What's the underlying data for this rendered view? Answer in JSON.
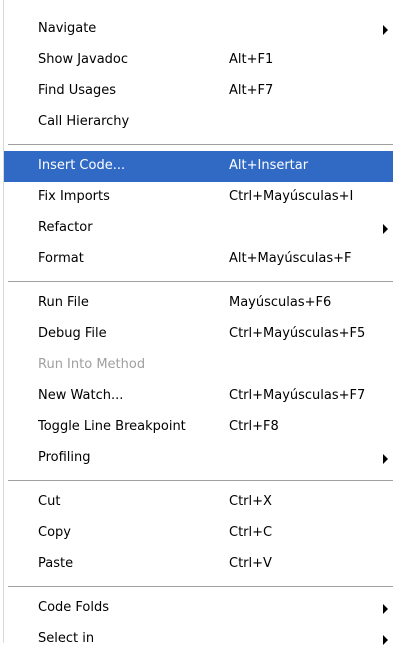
{
  "colors": {
    "selection": "#316ac5",
    "selection_text": "#ffffff",
    "disabled_text": "#a0a0a0",
    "separator": "#a0a0a0"
  },
  "menu": {
    "items": [
      {
        "label": "Navigate",
        "accel": "",
        "submenu": true,
        "selected": false,
        "disabled": false
      },
      {
        "label": "Show Javadoc",
        "accel": "Alt+F1",
        "submenu": false,
        "selected": false,
        "disabled": false
      },
      {
        "label": "Find Usages",
        "accel": "Alt+F7",
        "submenu": false,
        "selected": false,
        "disabled": false
      },
      {
        "label": "Call Hierarchy",
        "accel": "",
        "submenu": false,
        "selected": false,
        "disabled": false
      },
      {
        "label": "Insert Code...",
        "accel": "Alt+Insertar",
        "submenu": false,
        "selected": true,
        "disabled": false
      },
      {
        "label": "Fix Imports",
        "accel": "Ctrl+Mayúsculas+I",
        "submenu": false,
        "selected": false,
        "disabled": false
      },
      {
        "label": "Refactor",
        "accel": "",
        "submenu": true,
        "selected": false,
        "disabled": false
      },
      {
        "label": "Format",
        "accel": "Alt+Mayúsculas+F",
        "submenu": false,
        "selected": false,
        "disabled": false
      },
      {
        "label": "Run File",
        "accel": "Mayúsculas+F6",
        "submenu": false,
        "selected": false,
        "disabled": false
      },
      {
        "label": "Debug File",
        "accel": "Ctrl+Mayúsculas+F5",
        "submenu": false,
        "selected": false,
        "disabled": false
      },
      {
        "label": "Run Into Method",
        "accel": "",
        "submenu": false,
        "selected": false,
        "disabled": true
      },
      {
        "label": "New Watch...",
        "accel": "Ctrl+Mayúsculas+F7",
        "submenu": false,
        "selected": false,
        "disabled": false
      },
      {
        "label": "Toggle Line Breakpoint",
        "accel": "Ctrl+F8",
        "submenu": false,
        "selected": false,
        "disabled": false
      },
      {
        "label": "Profiling",
        "accel": "",
        "submenu": true,
        "selected": false,
        "disabled": false
      },
      {
        "label": "Cut",
        "accel": "Ctrl+X",
        "submenu": false,
        "selected": false,
        "disabled": false
      },
      {
        "label": "Copy",
        "accel": "Ctrl+C",
        "submenu": false,
        "selected": false,
        "disabled": false
      },
      {
        "label": "Paste",
        "accel": "Ctrl+V",
        "submenu": false,
        "selected": false,
        "disabled": false
      },
      {
        "label": "Code Folds",
        "accel": "",
        "submenu": true,
        "selected": false,
        "disabled": false
      },
      {
        "label": "Select in",
        "accel": "",
        "submenu": true,
        "selected": false,
        "disabled": false
      }
    ]
  }
}
